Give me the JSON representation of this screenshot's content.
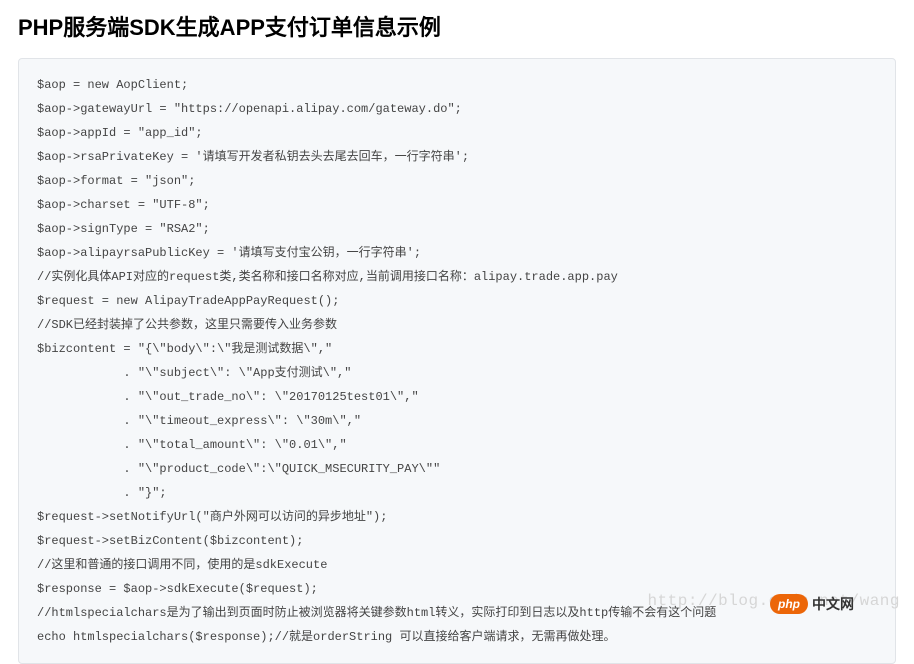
{
  "page": {
    "title": "PHP服务端SDK生成APP支付订单信息示例"
  },
  "code": {
    "lines": [
      "$aop = new AopClient;",
      "$aop->gatewayUrl = \"https://openapi.alipay.com/gateway.do\";",
      "$aop->appId = \"app_id\";",
      "$aop->rsaPrivateKey = '请填写开发者私钥去头去尾去回车，一行字符串';",
      "$aop->format = \"json\";",
      "$aop->charset = \"UTF-8\";",
      "$aop->signType = \"RSA2\";",
      "$aop->alipayrsaPublicKey = '请填写支付宝公钥，一行字符串';",
      "//实例化具体API对应的request类,类名称和接口名称对应,当前调用接口名称：alipay.trade.app.pay",
      "$request = new AlipayTradeAppPayRequest();",
      "//SDK已经封装掉了公共参数，这里只需要传入业务参数",
      "$bizcontent = \"{\\\"body\\\":\\\"我是测试数据\\\",\"",
      "            . \"\\\"subject\\\": \\\"App支付测试\\\",\"",
      "            . \"\\\"out_trade_no\\\": \\\"20170125test01\\\",\"",
      "            . \"\\\"timeout_express\\\": \\\"30m\\\",\"",
      "            . \"\\\"total_amount\\\": \\\"0.01\\\",\"",
      "            . \"\\\"product_code\\\":\\\"QUICK_MSECURITY_PAY\\\"\"",
      "            . \"}\";",
      "$request->setNotifyUrl(\"商户外网可以访问的异步地址\");",
      "$request->setBizContent($bizcontent);",
      "//这里和普通的接口调用不同，使用的是sdkExecute",
      "$response = $aop->sdkExecute($request);",
      "//htmlspecialchars是为了输出到页面时防止被浏览器将关键参数html转义，实际打印到日志以及http传输不会有这个问题",
      "echo htmlspecialchars($response);//就是orderString 可以直接给客户端请求，无需再做处理。"
    ]
  },
  "watermark": {
    "text": "http://blog.csdn.net/wang"
  },
  "brand": {
    "badge": "php",
    "text": "中文网"
  }
}
